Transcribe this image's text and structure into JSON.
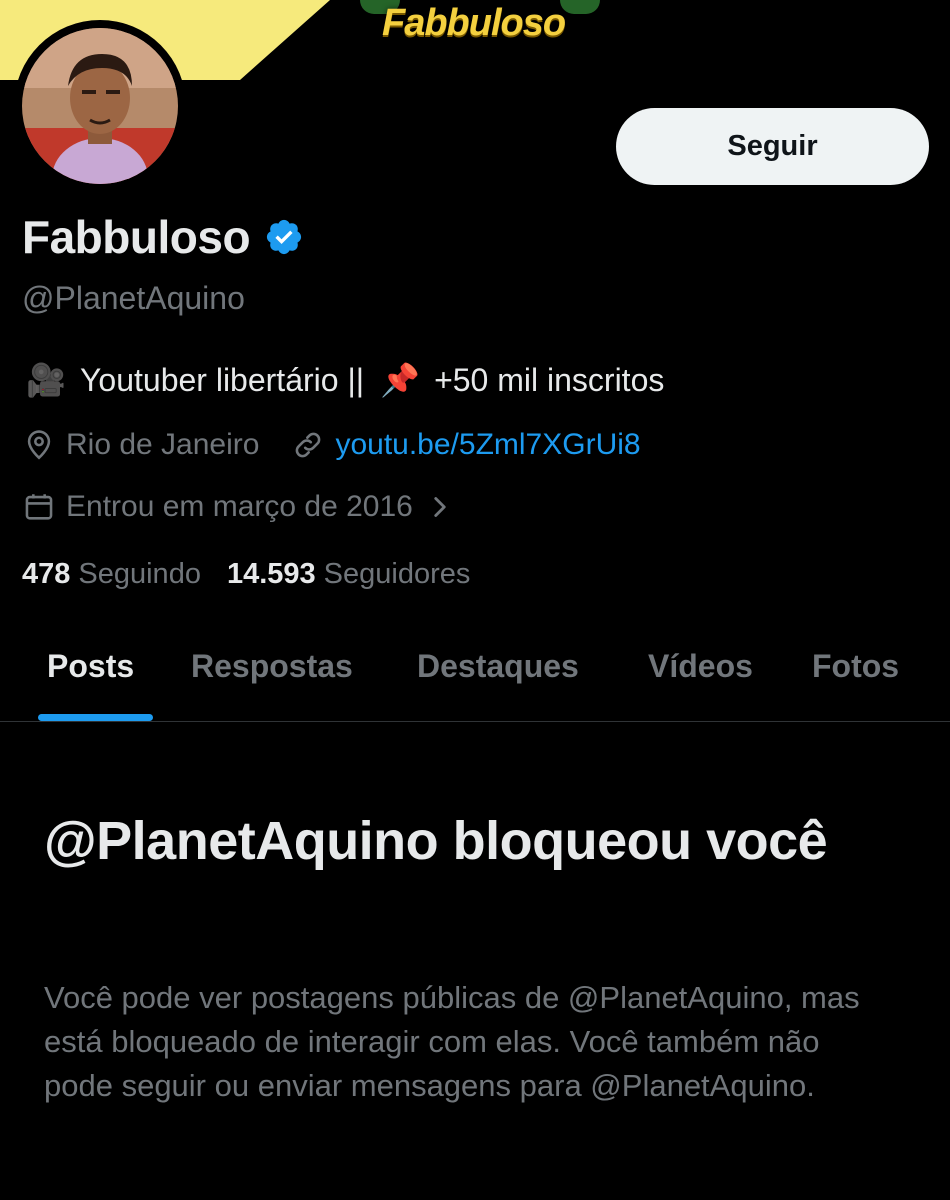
{
  "banner": {
    "logo_text": "Fabbuloso",
    "accent_color": "#f4d03f"
  },
  "profile": {
    "avatar_icon": "profile-photo",
    "follow_label": "Seguir",
    "display_name": "Fabbuloso",
    "verified_icon": "verified-badge-icon",
    "handle": "@PlanetAquino",
    "bio": {
      "emoji_1": "🎥",
      "text_1": "Youtuber libertário ||",
      "emoji_2": "📌",
      "text_2": "+50 mil inscritos"
    },
    "location": "Rio de Janeiro",
    "link": "youtu.be/5Zml7XGrUi8",
    "joined": "Entrou em março de 2016",
    "following_count": "478",
    "following_label": "Seguindo",
    "followers_count": "14.593",
    "followers_label": "Seguidores"
  },
  "tabs": [
    {
      "label": "Posts",
      "active": true
    },
    {
      "label": "Respostas",
      "active": false
    },
    {
      "label": "Destaques",
      "active": false
    },
    {
      "label": "Vídeos",
      "active": false
    },
    {
      "label": "Fotos",
      "active": false
    }
  ],
  "blocked": {
    "title": "@PlanetAquino bloqueou você",
    "description": "Você pode ver postagens públicas de @PlanetAquino, mas está bloqueado de interagir com elas. Você também não pode seguir ou enviar mensagens para @PlanetAquino."
  },
  "colors": {
    "background": "#000000",
    "text_primary": "#e7e9ea",
    "text_secondary": "#71767b",
    "link": "#1d9bf0",
    "verified": "#1d9bf0"
  }
}
